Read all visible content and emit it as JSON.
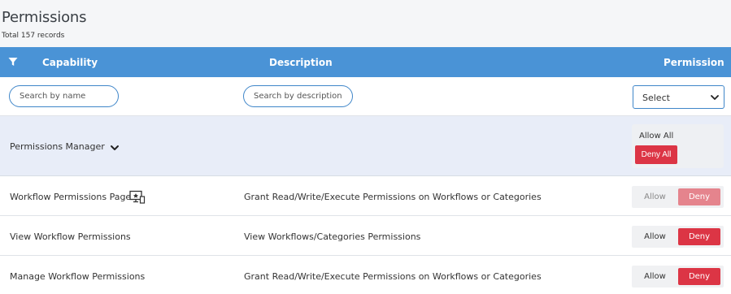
{
  "page": {
    "title": "Permissions",
    "record_count": "Total 157 records"
  },
  "table": {
    "columns": {
      "filter_icon": "filter-icon",
      "capability": "Capability",
      "description": "Description",
      "permission": "Permission"
    },
    "filters": {
      "name_placeholder": "Search by name",
      "description_placeholder": "Search by description",
      "permission_select_value": "Select"
    },
    "group": {
      "name": "Permissions Manager",
      "allow_all_label": "Allow All",
      "deny_all_label": "Deny All"
    },
    "rows": [
      {
        "capability": "Workflow Permissions Page",
        "description": "Grant Read/Write/Execute Permissions on Workflows or Categories",
        "allow_label": "Allow",
        "deny_label": "Deny",
        "selected": "Deny",
        "disabled": true,
        "icon": "screen-settings-icon"
      },
      {
        "capability": "View Workflow Permissions",
        "description": "View Workflows/Categories Permissions",
        "allow_label": "Allow",
        "deny_label": "Deny",
        "selected": "Deny",
        "disabled": false
      },
      {
        "capability": "Manage Workflow Permissions",
        "description": "Grant Read/Write/Execute Permissions on Workflows or Categories",
        "allow_label": "Allow",
        "deny_label": "Deny",
        "selected": "Deny",
        "disabled": false
      }
    ]
  },
  "colors": {
    "header_blue": "#4a93d6",
    "deny_red": "#dc3545",
    "deny_red_disabled": "#e5848d",
    "group_bg": "#e8edf8"
  }
}
